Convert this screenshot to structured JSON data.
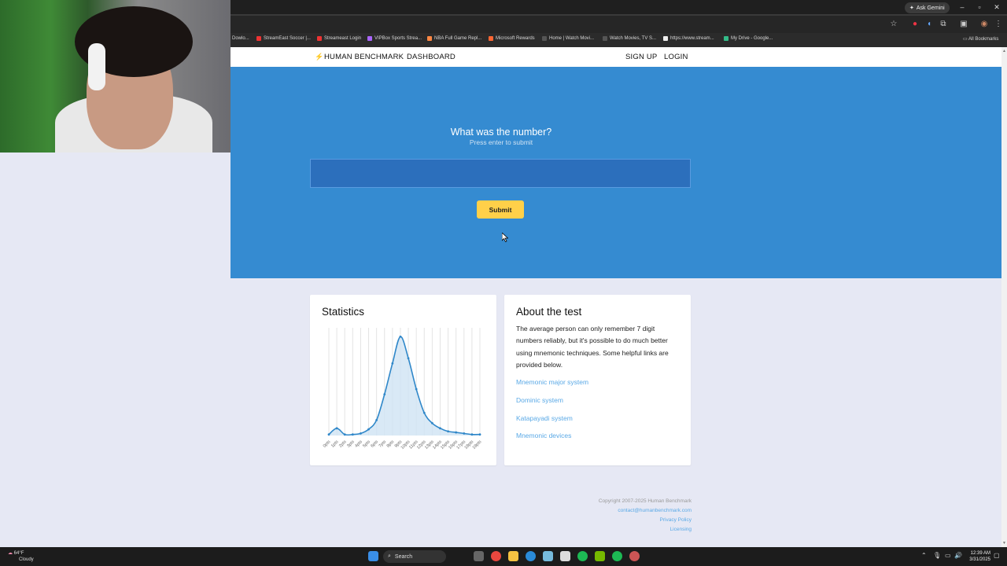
{
  "browser": {
    "gemini_label": "Ask Gemini",
    "bookmarks": [
      "Dowlo...",
      "StreamEast Soccer |...",
      "Streameast Login",
      "VIPBox Sports Strea...",
      "NBA Full Game Repl...",
      "Microsoft Rewards",
      "Home | Watch Movi...",
      "Watch Movies, TV S...",
      "https://www.stream...",
      "My Drive - Google..."
    ],
    "all_bookmarks": "All Bookmarks"
  },
  "nav": {
    "brand": "HUMAN BENCHMARK",
    "dashboard": "DASHBOARD",
    "signup": "SIGN UP",
    "login": "LOGIN"
  },
  "hero": {
    "question": "What was the number?",
    "hint": "Press enter to submit",
    "input_value": "",
    "submit": "Submit"
  },
  "statistics": {
    "title": "Statistics"
  },
  "chart_data": {
    "type": "area",
    "categories": [
      "0pts",
      "1pts",
      "2pts",
      "3pts",
      "4pts",
      "5pts",
      "6pts",
      "7pts",
      "8pts",
      "9pts",
      "10pts",
      "11pts",
      "12pts",
      "13pts",
      "14pts",
      "15pts",
      "16pts",
      "17pts",
      "18pts",
      "19pts"
    ],
    "series": [
      {
        "values": [
          1,
          7,
          1,
          1,
          2,
          6,
          15,
          40,
          70,
          96,
          75,
          45,
          22,
          12,
          7,
          4,
          3,
          2,
          1,
          1
        ]
      }
    ],
    "ylim": [
      0,
      100
    ],
    "grid": true
  },
  "about": {
    "title": "About the test",
    "text": "The average person can only remember 7 digit numbers reliably, but it's possible to do much better using mnemonic techniques. Some helpful links are provided below.",
    "links": [
      "Mnemonic major system",
      "Dominic system",
      "Katapayadi system",
      "Mnemonic devices"
    ]
  },
  "footer": {
    "copyright": "Copyright 2007-2025 Human Benchmark",
    "email": "contact@humanbenchmark.com",
    "privacy": "Privacy Policy",
    "licensing": "Licensing"
  },
  "taskbar": {
    "temp": "64°F",
    "weather": "Cloudy",
    "search": "Search",
    "time": "12:39 AM",
    "date": "3/31/2025"
  },
  "colors": {
    "hero": "#358bd1",
    "button": "#ffd049",
    "link": "#5aa9e6",
    "chart_line": "#2f87c9",
    "chart_fill": "#cfe3f4"
  }
}
